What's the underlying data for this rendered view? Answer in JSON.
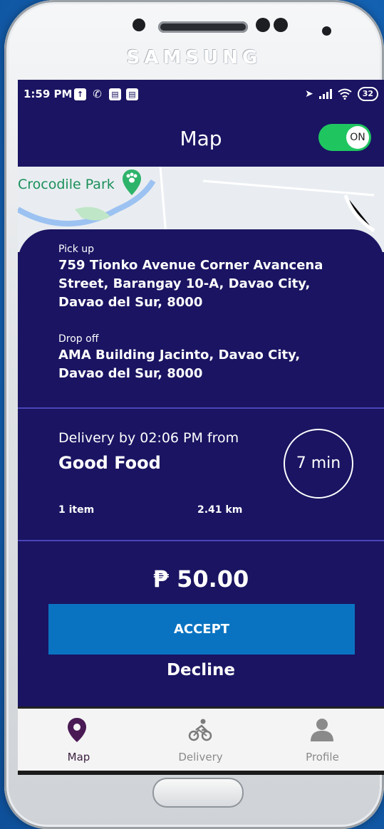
{
  "device": {
    "brand": "SAMSUNG"
  },
  "status_bar": {
    "time": "1:59 PM",
    "battery": "32",
    "icons": [
      "upload-icon",
      "whatsapp-icon",
      "app-icon",
      "app-icon",
      "location-arrow-icon",
      "signal-icon",
      "wifi-icon"
    ]
  },
  "header": {
    "title": "Map",
    "toggle_label": "ON"
  },
  "map": {
    "poi_label": "Crocodile Park"
  },
  "order": {
    "pickup_label": "Pick up",
    "pickup_address": "759 Tionko Avenue Corner Avancena Street, Barangay 10-A, Davao City, Davao del Sur, 8000",
    "dropoff_label": "Drop off",
    "dropoff_address": "AMA Building Jacinto, Davao City, Davao del Sur, 8000",
    "delivery_text": "Delivery by 02:06 PM from",
    "restaurant": "Good Food",
    "eta": "7 min",
    "items": "1 item",
    "distance": "2.41 km",
    "price": "₱ 50.00",
    "accept_label": "ACCEPT",
    "decline_label": "Decline"
  },
  "nav": {
    "items": [
      {
        "label": "Map",
        "icon": "map-pin-icon",
        "active": true
      },
      {
        "label": "Delivery",
        "icon": "bike-icon",
        "active": false
      },
      {
        "label": "Profile",
        "icon": "user-icon",
        "active": false
      }
    ]
  },
  "colors": {
    "primary": "#1a1462",
    "accent": "#0a73c1",
    "toggle_on": "#1fc660",
    "nav_active": "#3a1f3f",
    "divider": "#4a45b8"
  }
}
